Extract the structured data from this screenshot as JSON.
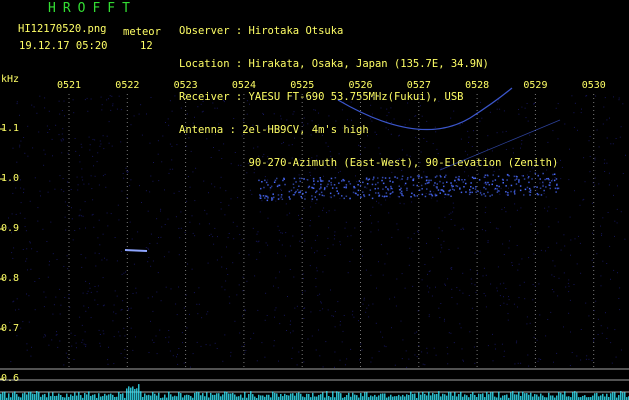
{
  "header": {
    "title": "HROFFT",
    "filename": "HI12170520.png",
    "datetime": "19.12.17 05:20",
    "meteor_label": "meteor",
    "meteor_count": "12",
    "observer_label": "Observer",
    "observer": "Hirotaka Otsuka",
    "location_label": "Location",
    "location": "Hirakata, Osaka, Japan (135.7E, 34.9N)",
    "receiver_label": "Receiver",
    "receiver": "YAESU FT-690 53.755MHz(Fukui), USB",
    "antenna_label": "Antenna",
    "antenna": "2el-HB9CV, 4m's high",
    "antenna_line2": "90-270-Azimuth (East-West), 90-Elevation (Zenith)"
  },
  "axis": {
    "y_unit": "kHz",
    "y_ticks": [
      "1.1",
      "1.0",
      "0.9",
      "0.8",
      "0.7",
      "0.6"
    ],
    "x_ticks": [
      "0521",
      "0522",
      "0523",
      "0524",
      "0525",
      "0526",
      "0527",
      "0528",
      "0529",
      "0530"
    ]
  },
  "colors": {
    "label": "#ffff66",
    "title": "#33dd33",
    "signal": "#4a6bff",
    "noise": "#1a1a70",
    "spectrum": "#33ddee"
  }
}
